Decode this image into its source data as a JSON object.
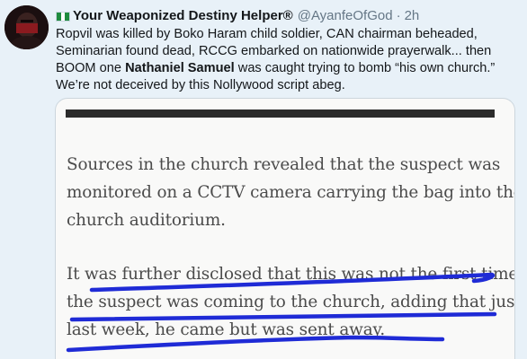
{
  "tweet": {
    "display_name": "Your Weaponized Destiny Helper®",
    "handle": "@AyanfeOfGod",
    "separator": "·",
    "time": "2h",
    "text_line1": "Ropvil was killed by Boko Haram child soldier, CAN chairman beheaded,",
    "text_line2": "Seminarian found dead, RCCG embarked on nationwide prayerwalk... then",
    "text_line3_before": "BOOM one ",
    "text_line3_bold": "Nathaniel Samuel",
    "text_line3_after": " was caught trying to bomb “his own church.”",
    "text_line4": "We’re not deceived by this Nollywood script abeg."
  },
  "article": {
    "para1_lines": [
      "Sources in the church revealed that the suspect was",
      "monitored on a CCTV camera carrying the bag into the",
      "church auditorium."
    ],
    "para2_lines": [
      "It was further disclosed that this was not the first time",
      "the suspect was coming to the church, adding that just",
      "last week, he came but was sent away."
    ]
  },
  "colors": {
    "background": "#e8f1f8",
    "text": "#14171a",
    "muted": "#657786",
    "underline": "#1f2bd6",
    "flag_green": "#1e8b3e"
  },
  "icons": [
    "nigeria-flag-icon",
    "avatar-image"
  ]
}
